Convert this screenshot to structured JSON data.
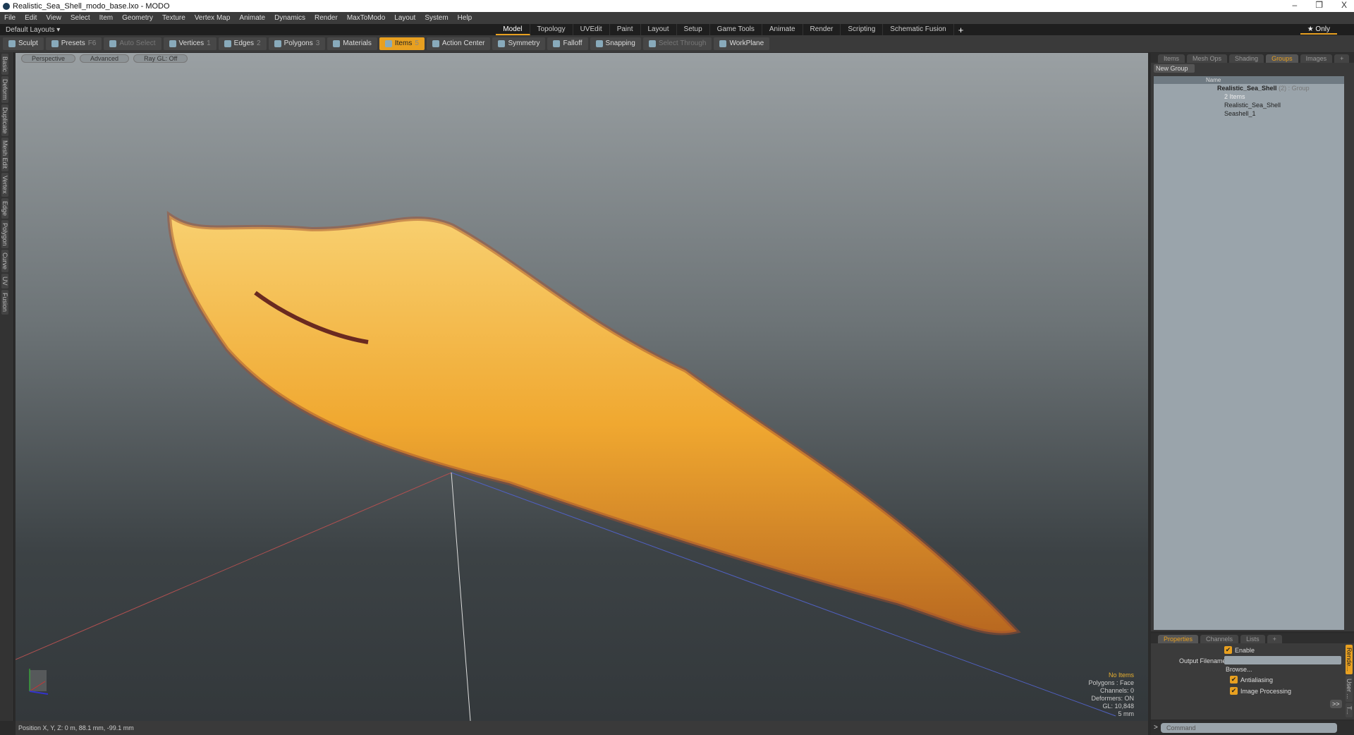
{
  "window": {
    "title": "Realistic_Sea_Shell_modo_base.lxo - MODO",
    "controls": [
      "–",
      "❐",
      "X"
    ]
  },
  "menu": [
    "File",
    "Edit",
    "View",
    "Select",
    "Item",
    "Geometry",
    "Texture",
    "Vertex Map",
    "Animate",
    "Dynamics",
    "Render",
    "MaxToModo",
    "Layout",
    "System",
    "Help"
  ],
  "layouts": {
    "dropdown": "Default Layouts ▾",
    "tabs": [
      "Model",
      "Topology",
      "UVEdit",
      "Paint",
      "Layout",
      "Setup",
      "Game Tools",
      "Animate",
      "Render",
      "Scripting",
      "Schematic Fusion"
    ],
    "active": "Model",
    "add": "+",
    "only": "★ Only"
  },
  "toolbar": [
    {
      "label": "Sculpt"
    },
    {
      "label": "Presets",
      "key": "F6"
    },
    {
      "label": "Auto Select",
      "dim": true
    },
    {
      "label": "Vertices",
      "key": "1"
    },
    {
      "label": "Edges",
      "key": "2"
    },
    {
      "label": "Polygons",
      "key": "3"
    },
    {
      "label": "Materials"
    },
    {
      "label": "Items",
      "key": "5",
      "active": true
    },
    {
      "label": "Action Center"
    },
    {
      "label": "Symmetry"
    },
    {
      "label": "Falloff"
    },
    {
      "label": "Snapping"
    },
    {
      "label": "Select Through",
      "dim": true
    },
    {
      "label": "WorkPlane"
    }
  ],
  "left_tabs": [
    "Basic",
    "Deform",
    "Duplicate",
    "Mesh Edit",
    "Vertex",
    "Edge",
    "Polygon",
    "Curve",
    "UV",
    "Fusion"
  ],
  "viewport": {
    "buttons": [
      "Perspective",
      "Advanced",
      "Ray GL: Off"
    ],
    "info": {
      "selection": "No Items",
      "polygons": "Polygons : Face",
      "channels": "Channels: 0",
      "deformers": "Deformers: ON",
      "gl": "GL: 10,848",
      "scale": "5 mm"
    }
  },
  "status": "Position X, Y, Z:   0 m, 88.1 mm, -99.1 mm",
  "right_panel": {
    "tabs": [
      "Items",
      "Mesh Ops",
      "Shading",
      "Groups",
      "Images",
      "+"
    ],
    "active": "Groups",
    "new_group": "New Group",
    "column": "Name",
    "group": {
      "name": "Realistic_Sea_Shell",
      "count": "(2)",
      "type": ": Group",
      "sub": "2 Items"
    },
    "children": [
      "Realistic_Sea_Shell",
      "Seashell_1"
    ]
  },
  "properties": {
    "tabs": [
      "Properties",
      "Channels",
      "Lists",
      "+"
    ],
    "active": "Properties",
    "enable": "Enable",
    "output_label": "Output Filename",
    "browse": "Browse...",
    "antialiasing": "Antialiasing",
    "image_processing": "Image Processing",
    "more": ">>",
    "side_tabs": [
      "Rende...",
      "User ...",
      "T..."
    ]
  },
  "command": {
    "placeholder": "Command"
  },
  "colors": {
    "accent": "#e8a020"
  }
}
